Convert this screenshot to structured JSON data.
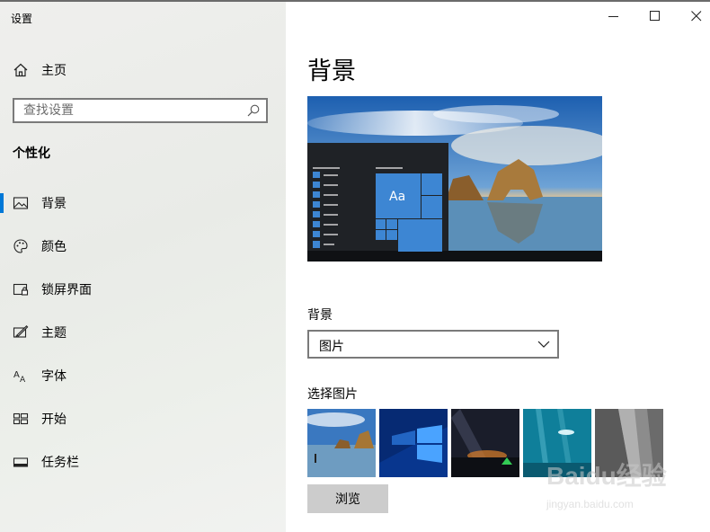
{
  "window": {
    "title": "设置"
  },
  "sidebar": {
    "home_label": "主页",
    "search_placeholder": "查找设置",
    "section_heading": "个性化",
    "items": [
      {
        "label": "背景",
        "icon": "picture-icon",
        "selected": true
      },
      {
        "label": "颜色",
        "icon": "palette-icon",
        "selected": false
      },
      {
        "label": "锁屏界面",
        "icon": "lock-screen-icon",
        "selected": false
      },
      {
        "label": "主题",
        "icon": "themes-icon",
        "selected": false
      },
      {
        "label": "字体",
        "icon": "fonts-icon",
        "selected": false
      },
      {
        "label": "开始",
        "icon": "start-icon",
        "selected": false
      },
      {
        "label": "任务栏",
        "icon": "taskbar-icon",
        "selected": false
      }
    ]
  },
  "main": {
    "title": "背景",
    "preview": {
      "tile_text": "Aa"
    },
    "background_label": "背景",
    "background_value": "图片",
    "choose_picture_label": "选择图片",
    "thumbnails": [
      {
        "name": "beach-rock-thumbnail"
      },
      {
        "name": "windows-light-thumbnail"
      },
      {
        "name": "night-sky-thumbnail"
      },
      {
        "name": "underwater-thumbnail"
      },
      {
        "name": "rock-cliff-thumbnail"
      }
    ],
    "browse_label": "浏览"
  },
  "watermark": {
    "text": "Baidu经验",
    "url": "jingyan.baidu.com"
  },
  "colors": {
    "accent": "#0078d7",
    "sidebar_bg": "#ecefea",
    "browse_button_bg": "#cccccc"
  }
}
